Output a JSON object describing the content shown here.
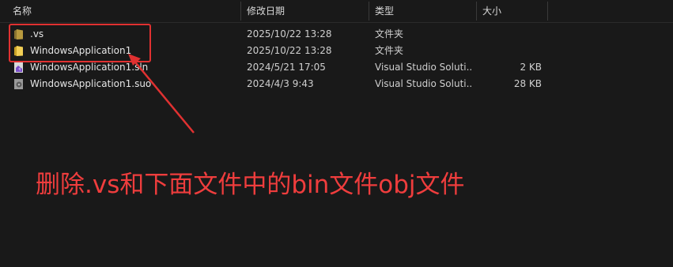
{
  "columns": {
    "name": "名称",
    "modified": "修改日期",
    "type": "类型",
    "size": "大小"
  },
  "rows": [
    {
      "icon": "folder-icon",
      "name": ".vs",
      "modified": "2025/10/22 13:28",
      "type": "文件夹",
      "size": ""
    },
    {
      "icon": "folder-icon",
      "name": "WindowsApplication1",
      "modified": "2025/10/22 13:28",
      "type": "文件夹",
      "size": ""
    },
    {
      "icon": "visual-studio-solution-icon",
      "name": "WindowsApplication1.sln",
      "modified": "2024/5/21 17:05",
      "type": "Visual Studio Soluti...",
      "size": "2 KB"
    },
    {
      "icon": "suo-file-icon",
      "name": "WindowsApplication1.suo",
      "modified": "2024/4/3 9:43",
      "type": "Visual Studio Soluti...",
      "size": "28 KB"
    }
  ],
  "annotation": {
    "text": "删除.vs和下面文件中的bin文件obj文件",
    "color": "#ef3d3d"
  },
  "colors": {
    "background": "#191919",
    "folder": "#e8c14a",
    "highlight": "#e03131"
  }
}
